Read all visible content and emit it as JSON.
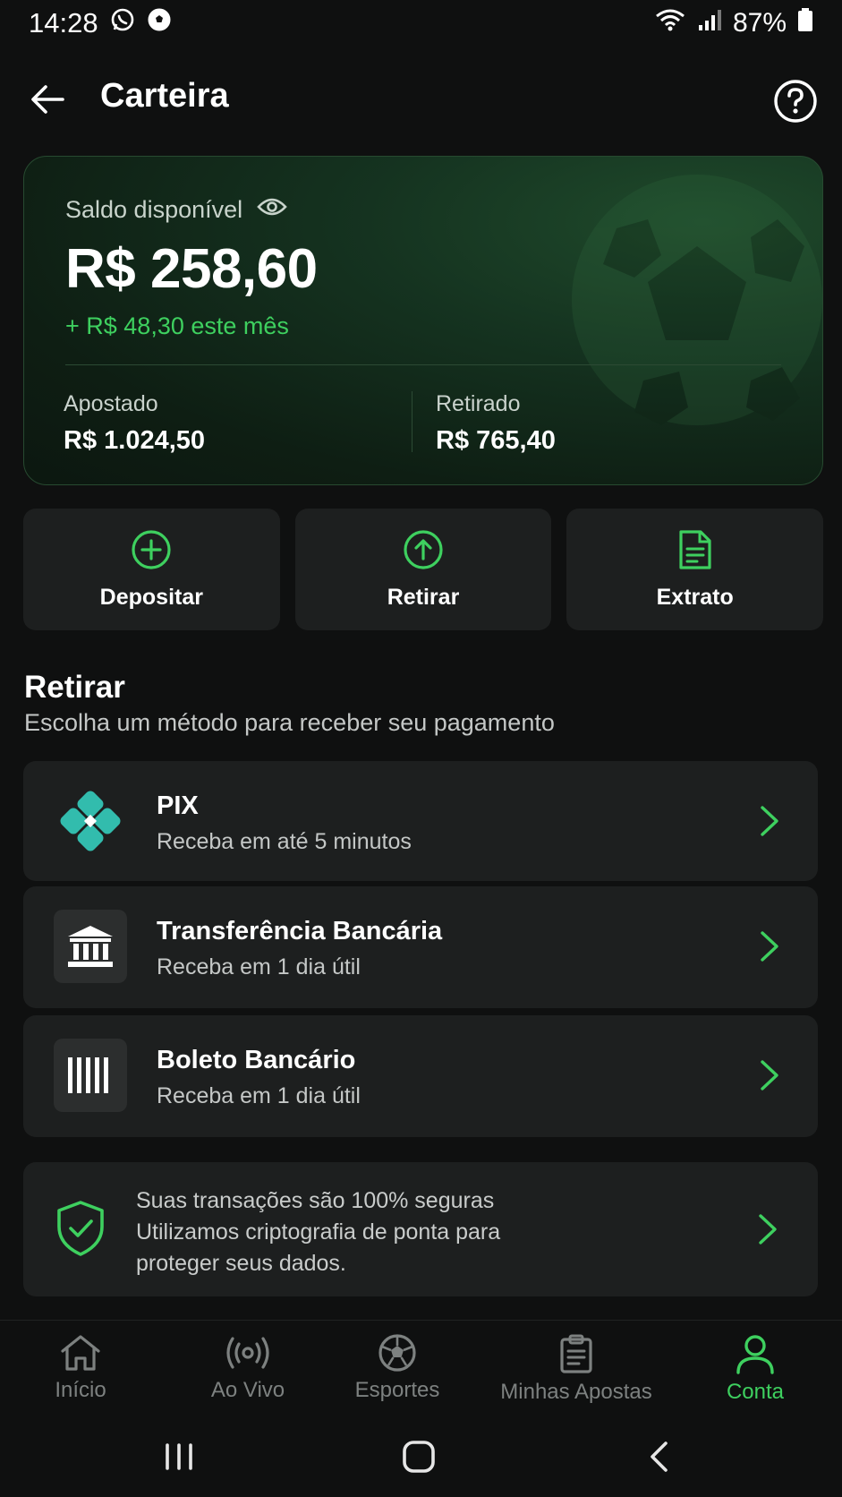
{
  "status_bar": {
    "time": "14:28",
    "left_icons": [
      "whatsapp-icon",
      "soccer-ball-icon"
    ],
    "right_icons": [
      "wifi-icon",
      "signal-icon",
      "battery-icon"
    ],
    "battery": "87%"
  },
  "header": {
    "title": "Carteira",
    "back_icon": "arrow-left-icon",
    "help_icon": "question-circle-icon"
  },
  "balance": {
    "label": "Saldo disponível",
    "value": "R$ 258,60",
    "month_change": "+ R$ 48,30 este mês",
    "stats": [
      {
        "label": "Apostado",
        "value": "R$ 1.024,50"
      },
      {
        "label": "Retirado",
        "value": "R$ 765,40"
      }
    ]
  },
  "actions": [
    {
      "label": "Depositar",
      "icon": "plus-circle-icon"
    },
    {
      "label": "Retirar",
      "icon": "arrow-up-circle-icon"
    },
    {
      "label": "Extrato",
      "icon": "document-icon"
    }
  ],
  "withdraw": {
    "title": "Retirar",
    "subtitle": "Escolha um método para receber seu pagamento",
    "methods": [
      {
        "name": "PIX",
        "desc": "Receba em até 5 minutos",
        "icon": "pix-icon"
      },
      {
        "name": "Transferência Bancária",
        "desc": "Receba em 1 dia útil",
        "icon": "bank-icon"
      },
      {
        "name": "Boleto Bancário",
        "desc": "Receba em 1 dia útil",
        "icon": "barcode-icon"
      }
    ]
  },
  "security": {
    "line1": "Suas transações são 100% seguras",
    "line2": "Utilizamos criptografia de ponta para",
    "line3": "proteger seus dados."
  },
  "bottom_nav": [
    {
      "label": "Início",
      "icon": "home-icon",
      "active": false
    },
    {
      "label": "Ao Vivo",
      "icon": "live-broadcast-icon",
      "active": false
    },
    {
      "label": "Esportes",
      "icon": "soccer-ball-icon",
      "active": false
    },
    {
      "label": "Minhas Apostas",
      "icon": "clipboard-icon",
      "active": false
    },
    {
      "label": "Conta",
      "icon": "user-icon",
      "active": true
    }
  ],
  "colors": {
    "accent": "#3ed05f",
    "background": "#0f1010",
    "card": "#1d1f1f",
    "pix": "#32bcad"
  }
}
